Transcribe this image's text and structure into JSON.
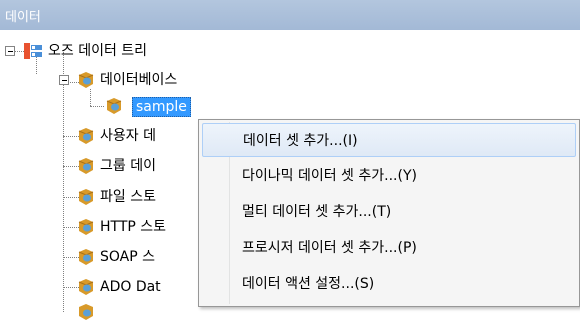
{
  "panel": {
    "title": "데이터"
  },
  "tree": {
    "root": {
      "label": "오즈 데이터 트리",
      "icon": "data-tree-root-icon"
    },
    "database": {
      "label": "데이터베이스",
      "icon": "database-icon"
    },
    "sample": {
      "label": "sample",
      "icon": "database-icon"
    },
    "items": [
      {
        "label": "사용자 데",
        "icon": "database-icon"
      },
      {
        "label": "그룹 데이",
        "icon": "database-icon"
      },
      {
        "label": "파일 스토",
        "icon": "database-icon"
      },
      {
        "label": "HTTP 스토",
        "icon": "database-icon"
      },
      {
        "label": "SOAP 스",
        "icon": "database-icon"
      },
      {
        "label": "ADO Dat",
        "icon": "database-icon"
      }
    ]
  },
  "context_menu": {
    "items": [
      {
        "label": "데이터 셋 추가...(I)",
        "highlighted": true
      },
      {
        "label": "다이나믹 데이터 셋 추가...(Y)",
        "highlighted": false
      },
      {
        "label": "멀티 데이터 셋 추가...(T)",
        "highlighted": false
      },
      {
        "label": "프로시저 데이터 셋 추가...(P)",
        "highlighted": false
      },
      {
        "label": "데이터 액션 설정...(S)",
        "highlighted": false
      }
    ]
  },
  "colors": {
    "titlebar": "#a3b9d6",
    "selection": "#3399ff",
    "menu_background": "#f5f5f5",
    "menu_highlight_border": "#aecff7"
  }
}
